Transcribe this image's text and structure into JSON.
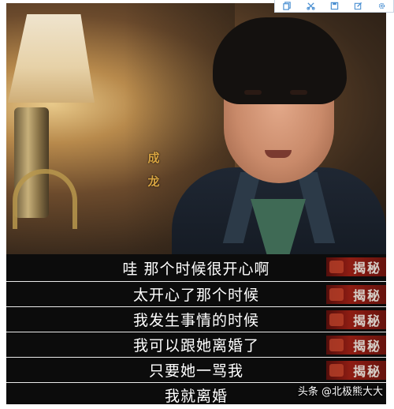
{
  "toolbar": {
    "icons": [
      "copy-icon",
      "crop-icon",
      "save-icon",
      "edit-icon",
      "settings-icon"
    ]
  },
  "video": {
    "name_tag": [
      "成",
      "龙"
    ],
    "show_logo": "揭秘",
    "subtitles": [
      "哇  那个时候很开心啊",
      "太开心了那个时候",
      "我发生事情的时候",
      "我可以跟她离婚了",
      "只要她一骂我",
      "我就离婚"
    ]
  },
  "watermark": "头条 @北极熊大大"
}
